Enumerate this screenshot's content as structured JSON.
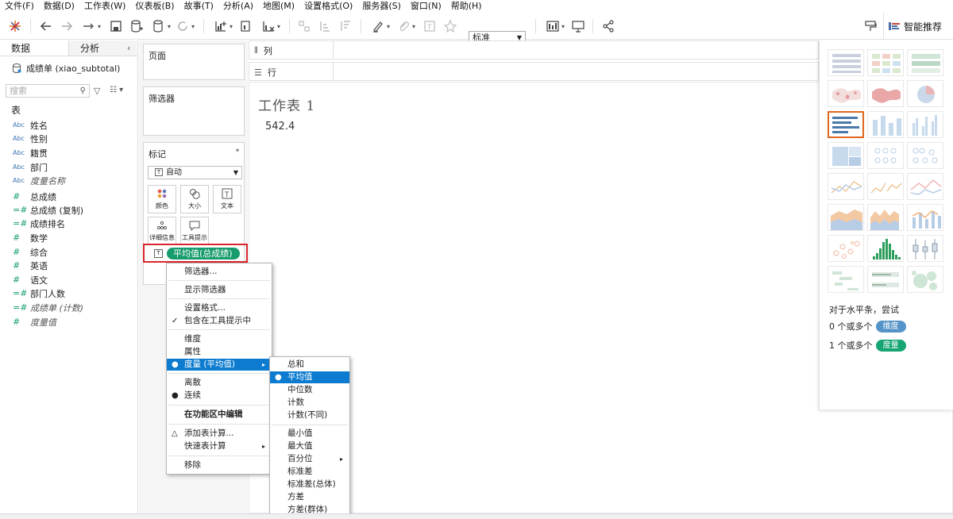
{
  "menubar": [
    "文件(F)",
    "数据(D)",
    "工作表(W)",
    "仪表板(B)",
    "故事(T)",
    "分析(A)",
    "地图(M)",
    "设置格式(O)",
    "服务器(S)",
    "窗口(N)",
    "帮助(H)"
  ],
  "toolbar": {
    "fit_select": "标准",
    "smart_recommend": "智能推荐"
  },
  "datapane": {
    "tab_data": "数据",
    "tab_analysis": "分析",
    "datasource": "成绩单 (xiao_subtotal)",
    "search_placeholder": "搜索",
    "section": "表",
    "fields": [
      {
        "type": "Abc",
        "name": "姓名",
        "italic": false
      },
      {
        "type": "Abc",
        "name": "性别",
        "italic": false
      },
      {
        "type": "Abc",
        "name": "籍贯",
        "italic": false
      },
      {
        "type": "Abc",
        "name": "部门",
        "italic": false
      },
      {
        "type": "Abc",
        "name": "度量名称",
        "italic": true
      },
      {
        "type": "#",
        "name": "总成绩",
        "italic": false
      },
      {
        "type": "=#",
        "name": "总成绩 (复制)",
        "italic": false
      },
      {
        "type": "=#",
        "name": "成绩排名",
        "italic": false
      },
      {
        "type": "#",
        "name": "数学",
        "italic": false
      },
      {
        "type": "#",
        "name": "综合",
        "italic": false
      },
      {
        "type": "#",
        "name": "英语",
        "italic": false
      },
      {
        "type": "#",
        "name": "语文",
        "italic": false
      },
      {
        "type": "=#",
        "name": "部门人数",
        "italic": false
      },
      {
        "type": "=#",
        "name": "成绩单 (计数)",
        "italic": true
      },
      {
        "type": "#",
        "name": "度量值",
        "italic": true
      }
    ]
  },
  "shelves": {
    "pages": "页面",
    "filters": "筛选器",
    "marks": "标记",
    "mark_type": "自动",
    "buttons": [
      "颜色",
      "大小",
      "文本",
      "详细信息",
      "工具提示"
    ],
    "pill": "平均值(总成绩)",
    "columns": "列",
    "rows": "行"
  },
  "sheet": {
    "title": "工作表 1",
    "value": "542.4"
  },
  "showme": {
    "hint": "对于水平条，尝试",
    "dim_line": "0 个或多个",
    "dim_badge": "维度",
    "meas_line": "1 个或多个",
    "meas_badge": "度量"
  },
  "context_menu": [
    {
      "label": "筛选器...",
      "mark": "",
      "sub": false
    },
    {
      "label": "显示筛选器",
      "mark": "",
      "sub": false
    },
    {
      "label": "设置格式...",
      "mark": "",
      "sub": false
    },
    {
      "label": "包含在工具提示中",
      "mark": "✓",
      "sub": false
    },
    {
      "label": "维度",
      "mark": "",
      "sub": false
    },
    {
      "label": "属性",
      "mark": "",
      "sub": false
    },
    {
      "label": "度量 (平均值)",
      "mark": "●",
      "sub": true
    },
    {
      "label": "离散",
      "mark": "",
      "sub": false
    },
    {
      "label": "连续",
      "mark": "●",
      "sub": false
    },
    {
      "label": "在功能区中编辑",
      "mark": "",
      "sub": false
    },
    {
      "label": "添加表计算...",
      "mark": "△",
      "sub": false
    },
    {
      "label": "快速表计算",
      "mark": "",
      "sub": true
    },
    {
      "label": "移除",
      "mark": "",
      "sub": false
    }
  ],
  "aggregation_menu": [
    {
      "label": "总和",
      "mark": "",
      "sub": false
    },
    {
      "label": "平均值",
      "mark": "●",
      "sub": false
    },
    {
      "label": "中位数",
      "mark": "",
      "sub": false
    },
    {
      "label": "计数",
      "mark": "",
      "sub": false
    },
    {
      "label": "计数(不同)",
      "mark": "",
      "sub": false
    },
    {
      "label": "最小值",
      "mark": "",
      "sub": false
    },
    {
      "label": "最大值",
      "mark": "",
      "sub": false
    },
    {
      "label": "百分位",
      "mark": "",
      "sub": true
    },
    {
      "label": "标准差",
      "mark": "",
      "sub": false
    },
    {
      "label": "标准差(总体)",
      "mark": "",
      "sub": false
    },
    {
      "label": "方差",
      "mark": "",
      "sub": false
    },
    {
      "label": "方差(群体)",
      "mark": "",
      "sub": false
    }
  ],
  "colors": {
    "highlight": "#0d7cd0",
    "pill": "#179c6c",
    "dimension": "#5594c8",
    "measure": "#17a673",
    "selected_chart": "#e0651f"
  }
}
